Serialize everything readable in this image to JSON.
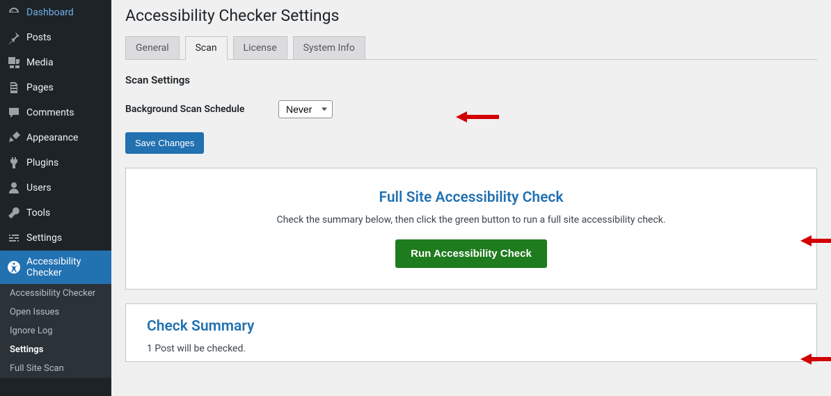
{
  "sidebar": {
    "items": [
      {
        "label": "Dashboard",
        "icon": "dashboard"
      },
      {
        "label": "Posts",
        "icon": "pin"
      },
      {
        "label": "Media",
        "icon": "media"
      },
      {
        "label": "Pages",
        "icon": "pages"
      },
      {
        "label": "Comments",
        "icon": "comments"
      },
      {
        "label": "Appearance",
        "icon": "appearance"
      },
      {
        "label": "Plugins",
        "icon": "plugin"
      },
      {
        "label": "Users",
        "icon": "users"
      },
      {
        "label": "Tools",
        "icon": "tools"
      },
      {
        "label": "Settings",
        "icon": "settings"
      },
      {
        "label": "Accessibility Checker",
        "icon": "accessibility",
        "active": true
      }
    ],
    "submenu": [
      {
        "label": "Accessibility Checker"
      },
      {
        "label": "Open Issues"
      },
      {
        "label": "Ignore Log"
      },
      {
        "label": "Settings",
        "current": true
      },
      {
        "label": "Full Site Scan"
      }
    ]
  },
  "page": {
    "title": "Accessibility Checker Settings",
    "tabs": [
      "General",
      "Scan",
      "License",
      "System Info"
    ],
    "active_tab": 1
  },
  "scan": {
    "heading": "Scan Settings",
    "schedule_label": "Background Scan Schedule",
    "schedule_value": "Never",
    "save_button": "Save Changes"
  },
  "full_check": {
    "title": "Full Site Accessibility Check",
    "description": "Check the summary below, then click the green button to run a full site accessibility check.",
    "button": "Run Accessibility Check"
  },
  "summary": {
    "title": "Check Summary",
    "line1": "1 Post will be checked."
  }
}
